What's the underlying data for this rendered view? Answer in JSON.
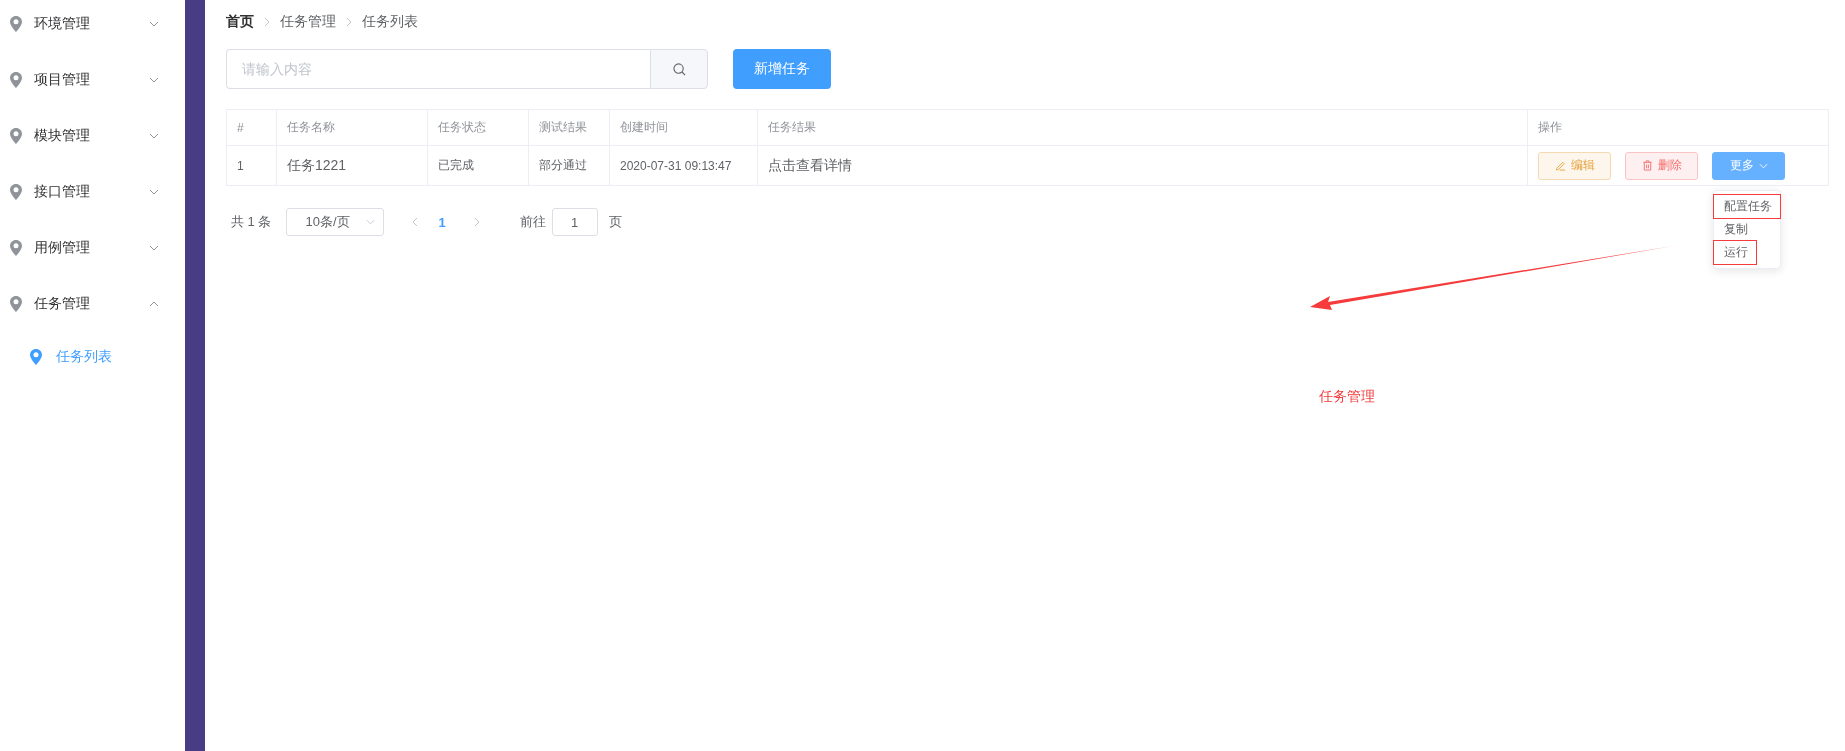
{
  "sidebar": {
    "items": [
      {
        "label": "环境管理",
        "expanded": false
      },
      {
        "label": "项目管理",
        "expanded": false
      },
      {
        "label": "模块管理",
        "expanded": false
      },
      {
        "label": "接口管理",
        "expanded": false
      },
      {
        "label": "用例管理",
        "expanded": false
      },
      {
        "label": "任务管理",
        "expanded": true,
        "children": [
          {
            "label": "任务列表",
            "selected": true
          }
        ]
      }
    ]
  },
  "breadcrumb": [
    "首页",
    "任务管理",
    "任务列表"
  ],
  "search": {
    "placeholder": "请输入内容"
  },
  "add_button": "新增任务",
  "table": {
    "columns": [
      "#",
      "任务名称",
      "任务状态",
      "测试结果",
      "创建时间",
      "任务结果",
      "操作"
    ],
    "rows": [
      {
        "cells": [
          "1",
          "任务1221",
          "已完成",
          "部分通过",
          "2020-07-31 09:13:47",
          "点击查看详情"
        ],
        "actions": {
          "edit": "编辑",
          "delete": "删除",
          "more": "更多"
        }
      }
    ]
  },
  "dropdown": {
    "items": [
      {
        "label": "配置任务",
        "highlighted": true
      },
      {
        "label": "复制",
        "highlighted": false
      },
      {
        "label": "运行",
        "highlighted": true
      }
    ]
  },
  "pagination": {
    "total": "共 1 条",
    "page_size": "10条/页",
    "pages": [
      {
        "label": "1",
        "selected": true
      }
    ],
    "goto_label": "前往",
    "goto_value": "1",
    "page_unit": "页"
  },
  "annotation": "任务管理"
}
